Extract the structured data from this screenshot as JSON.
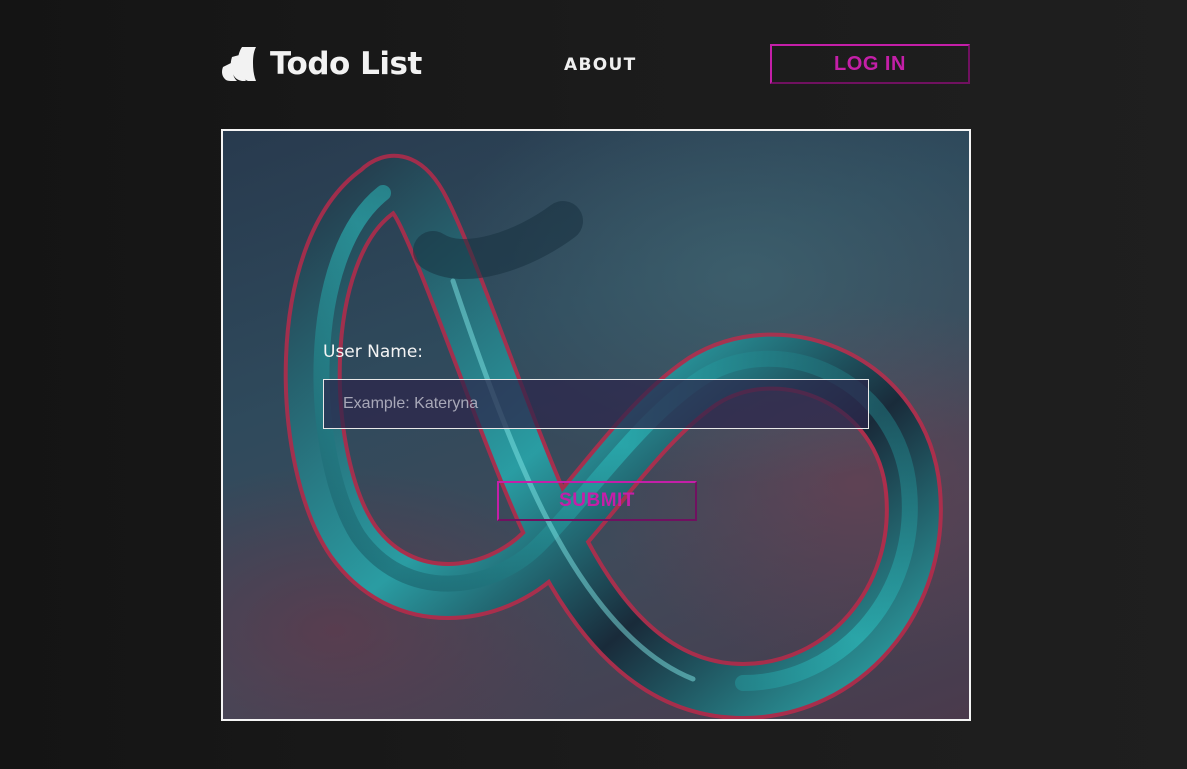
{
  "colors": {
    "accent": "#c41fa8",
    "text": "#f4f4f4",
    "background": "#1a1a1a"
  },
  "header": {
    "logo_icon": "logo-mark-icon",
    "title": "Todo List",
    "nav": {
      "about_label": "ABOUT"
    },
    "login_label": "LOG IN"
  },
  "form": {
    "username_label": "User Name:",
    "username_placeholder": "Example: Kateryna",
    "username_value": "",
    "submit_label": "SUBMIT"
  }
}
